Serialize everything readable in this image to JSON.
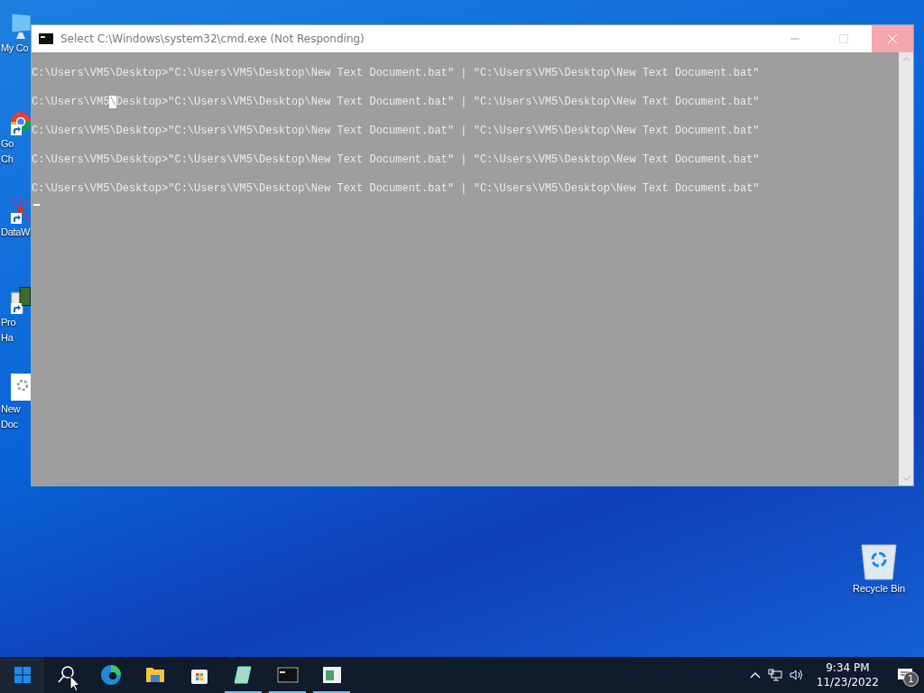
{
  "desktop_icons": [
    {
      "kind": "computer",
      "label_lines": [
        "My Co"
      ],
      "shortcut": false
    },
    {
      "kind": "browser",
      "label_lines": [
        "Go",
        "Ch"
      ],
      "shortcut": true
    },
    {
      "kind": "network",
      "label_lines": [
        "DataW"
      ],
      "shortcut": true
    },
    {
      "kind": "machine",
      "label_lines": [
        "Pro",
        "Ha"
      ],
      "shortcut": true
    },
    {
      "kind": "document",
      "label_lines": [
        "New",
        "Doc"
      ],
      "shortcut": false
    },
    {
      "kind": "recycle",
      "label_lines": [
        "Recycle Bin"
      ],
      "shortcut": false
    }
  ],
  "window": {
    "title": "Select C:\\Windows\\system32\\cmd.exe (Not Responding)",
    "console_lines": [
      {
        "segments": [
          {
            "text": "C:\\Users\\VM5\\Desktop>\"C:\\Users\\VM5\\Desktop\\New Text Document.bat\" | \"C:\\Users\\VM5\\Desktop\\New Text Document.bat\"",
            "selected": false
          }
        ]
      },
      {
        "segments": [
          {
            "text": "C:\\Users\\VM5",
            "selected": false
          },
          {
            "text": "\\",
            "selected": true
          },
          {
            "text": "Desktop>\"C:\\Users\\VM5\\Desktop\\New Text Document.bat\" | \"C:\\Users\\VM5\\Desktop\\New Text Document.bat\"",
            "selected": false
          }
        ]
      },
      {
        "segments": [
          {
            "text": "C:\\Users\\VM5\\Desktop>\"C:\\Users\\VM5\\Desktop\\New Text Document.bat\" | \"C:\\Users\\VM5\\Desktop\\New Text Document.bat\"",
            "selected": false
          }
        ]
      },
      {
        "segments": [
          {
            "text": "C:\\Users\\VM5\\Desktop>\"C:\\Users\\VM5\\Desktop\\New Text Document.bat\" | \"C:\\Users\\VM5\\Desktop\\New Text Document.bat\"",
            "selected": false
          }
        ]
      },
      {
        "segments": [
          {
            "text": "C:\\Users\\VM5\\Desktop>\"C:\\Users\\VM5\\Desktop\\New Text Document.bat\" | \"C:\\Users\\VM5\\Desktop\\New Text Document.bat\"",
            "selected": false
          }
        ]
      }
    ]
  },
  "taskbar": {
    "apps": [
      {
        "kind": "search",
        "running": false
      },
      {
        "kind": "edge",
        "running": false
      },
      {
        "kind": "folder",
        "running": false
      },
      {
        "kind": "store",
        "running": false
      },
      {
        "kind": "notepad",
        "running": true
      },
      {
        "kind": "terminal",
        "running": true
      },
      {
        "kind": "panel",
        "running": true
      }
    ],
    "clock": {
      "time": "9:34 PM",
      "date": "11/23/2022"
    },
    "notification_count": "1"
  }
}
